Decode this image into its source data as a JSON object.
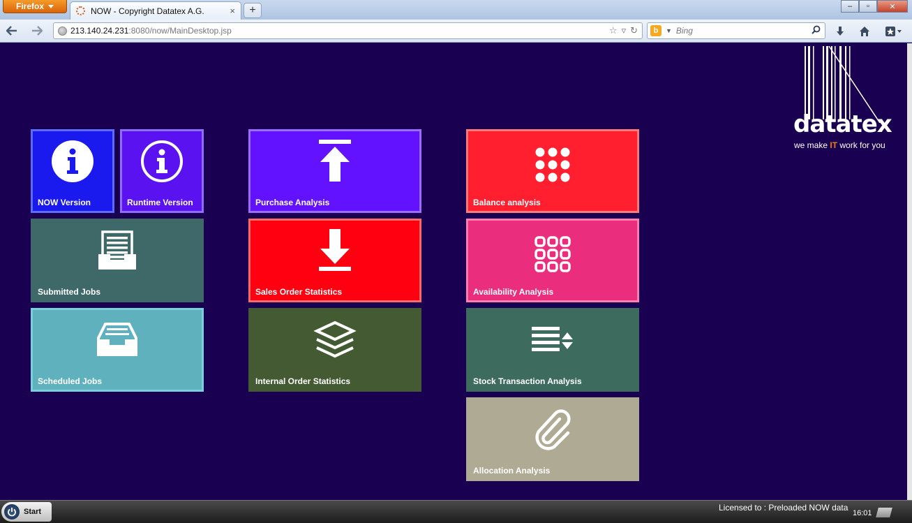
{
  "browser": {
    "menu_label": "Firefox",
    "tab_title": "NOW - Copyright Datatex A.G.",
    "tab_close": "×",
    "new_tab": "+",
    "url_host": "213.140.24.231",
    "url_rest": ":8080/now/MainDesktop.jsp",
    "search_engine_logo": "b",
    "search_placeholder": "Bing",
    "window_controls": {
      "minimize": "–",
      "maximize": "▫",
      "close": "✕"
    }
  },
  "logo": {
    "word": "datatex",
    "tagline_before": "we make ",
    "tagline_it": "IT",
    "tagline_after": " work for you"
  },
  "tiles": {
    "now_version": {
      "label": "NOW Version",
      "icon": "info-circle-icon",
      "color": "#1a1aee",
      "border": "#5e6bff"
    },
    "runtime_version": {
      "label": "Runtime Version",
      "icon": "info-outline-icon",
      "color": "#5a12f0",
      "border": "#8e6dff"
    },
    "submitted_jobs": {
      "label": "Submitted Jobs",
      "icon": "inbox-full-icon",
      "color": "#3f6868",
      "border": "#3f6868"
    },
    "scheduled_jobs": {
      "label": "Scheduled Jobs",
      "icon": "inbox-icon",
      "color": "#5fb1bd",
      "border": "#7ad0da"
    },
    "purchase_analysis": {
      "label": "Purchase Analysis",
      "icon": "upload-arrow-icon",
      "color": "#6212ff",
      "border": "#9a6dff"
    },
    "sales_order_statistics": {
      "label": "Sales Order Statistics",
      "icon": "download-arrow-icon",
      "color": "#ff0010",
      "border": "#ff6a6a"
    },
    "internal_order_statistics": {
      "label": "Internal Order Statistics",
      "icon": "layers-icon",
      "color": "#435a33",
      "border": "#435a33"
    },
    "balance_analysis": {
      "label": "Balance analysis",
      "icon": "dot-grid-icon",
      "color": "#ff1f2e",
      "border": "#ff7a7a"
    },
    "availability_analysis": {
      "label": "Availability Analysis",
      "icon": "ring-grid-icon",
      "color": "#ea2d7c",
      "border": "#ff7fb0"
    },
    "stock_transaction_analysis": {
      "label": "Stock Transaction Analysis",
      "icon": "sort-list-icon",
      "color": "#3d6b5e",
      "border": "#3d6b5e"
    },
    "allocation_analysis": {
      "label": "Allocation Analysis",
      "icon": "paperclip-icon",
      "color": "#aeaa93",
      "border": "#aeaa93"
    }
  },
  "taskbar": {
    "start_label": "Start",
    "licensed_text": "Licensed to : Preloaded NOW data",
    "clock": "16:01"
  }
}
